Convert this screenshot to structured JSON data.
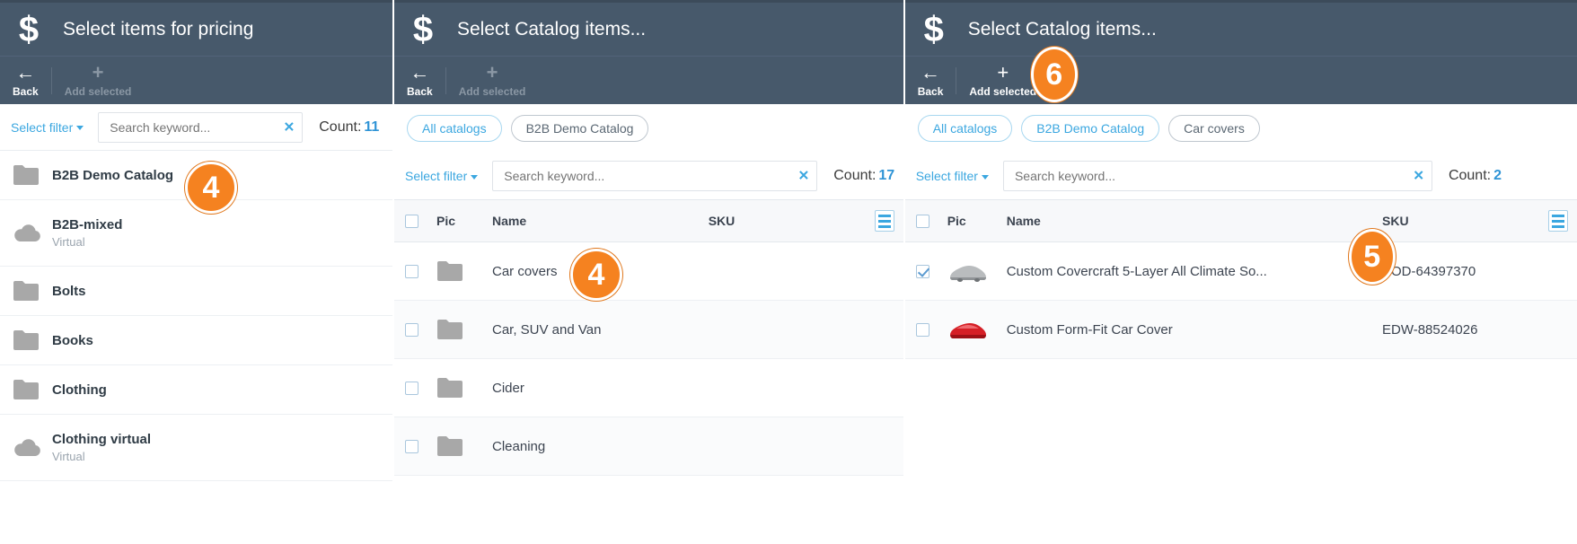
{
  "panels": [
    {
      "id": "panel-pricing",
      "title": "Select items for pricing",
      "logo_icon": "dollar-icon",
      "toolbar": {
        "back_label": "Back",
        "back_icon": "arrow-left-icon",
        "add_label": "Add selected",
        "add_icon": "plus-icon",
        "add_disabled": true
      },
      "filter": {
        "select_filter_label": "Select filter",
        "search_placeholder": "Search keyword...",
        "search_value": "",
        "clear_icon": "clear-icon",
        "count_label": "Count:",
        "count_value": "11"
      },
      "folders": [
        {
          "name": "B2B Demo Catalog",
          "sub": "",
          "icon": "folder-icon"
        },
        {
          "name": "B2B-mixed",
          "sub": "Virtual",
          "icon": "cloud-icon"
        },
        {
          "name": "Bolts",
          "sub": "",
          "icon": "folder-icon"
        },
        {
          "name": "Books",
          "sub": "",
          "icon": "folder-icon"
        },
        {
          "name": "Clothing",
          "sub": "",
          "icon": "folder-icon"
        },
        {
          "name": "Clothing virtual",
          "sub": "Virtual",
          "icon": "cloud-icon"
        }
      ],
      "badge": {
        "number": "4"
      }
    },
    {
      "id": "panel-catalog-items",
      "title": "Select Catalog items...",
      "logo_icon": "dollar-icon",
      "toolbar": {
        "back_label": "Back",
        "back_icon": "arrow-left-icon",
        "add_label": "Add selected",
        "add_icon": "plus-icon",
        "add_disabled": true
      },
      "breadcrumbs": [
        {
          "label": "All catalogs",
          "active": true
        },
        {
          "label": "B2B Demo Catalog",
          "active": false
        }
      ],
      "filter": {
        "select_filter_label": "Select filter",
        "search_placeholder": "Search keyword...",
        "search_value": "",
        "clear_icon": "clear-icon",
        "count_label": "Count:",
        "count_value": "17"
      },
      "table": {
        "columns": [
          "Pic",
          "Name",
          "SKU"
        ],
        "menu_icon": "list-menu-icon",
        "rows": [
          {
            "checked": false,
            "pic": "folder-icon",
            "name": "Car covers",
            "sku": ""
          },
          {
            "checked": false,
            "pic": "folder-icon",
            "name": "Car, SUV and Van",
            "sku": ""
          },
          {
            "checked": false,
            "pic": "folder-icon",
            "name": "Cider",
            "sku": ""
          },
          {
            "checked": false,
            "pic": "folder-icon",
            "name": "Cleaning",
            "sku": ""
          }
        ]
      },
      "badge": {
        "number": "4"
      }
    },
    {
      "id": "panel-car-covers",
      "title": "Select Catalog items...",
      "logo_icon": "dollar-icon",
      "toolbar": {
        "back_label": "Back",
        "back_icon": "arrow-left-icon",
        "add_label": "Add selected",
        "add_icon": "plus-icon",
        "add_disabled": false
      },
      "breadcrumbs": [
        {
          "label": "All catalogs",
          "active": true
        },
        {
          "label": "B2B Demo Catalog",
          "active": true
        },
        {
          "label": "Car covers",
          "active": false
        }
      ],
      "filter": {
        "select_filter_label": "Select filter",
        "search_placeholder": "Search keyword...",
        "search_value": "",
        "clear_icon": "clear-icon",
        "count_label": "Count:",
        "count_value": "2"
      },
      "table": {
        "columns": [
          "Pic",
          "Name",
          "SKU"
        ],
        "menu_icon": "list-menu-icon",
        "rows": [
          {
            "checked": true,
            "pic": "car-cover-grey-thumb",
            "name": "Custom Covercraft 5-Layer All Climate So...",
            "sku": "XOD-64397370"
          },
          {
            "checked": false,
            "pic": "car-cover-red-thumb",
            "name": "Custom Form-Fit Car Cover",
            "sku": "EDW-88524026"
          }
        ]
      },
      "badges": [
        {
          "number": "6"
        },
        {
          "number": "5"
        }
      ]
    }
  ],
  "colors": {
    "header_bg": "#47596b",
    "accent_blue": "#3ba7e0",
    "badge_orange": "#f58220",
    "folder_grey": "#a8a8a8"
  }
}
